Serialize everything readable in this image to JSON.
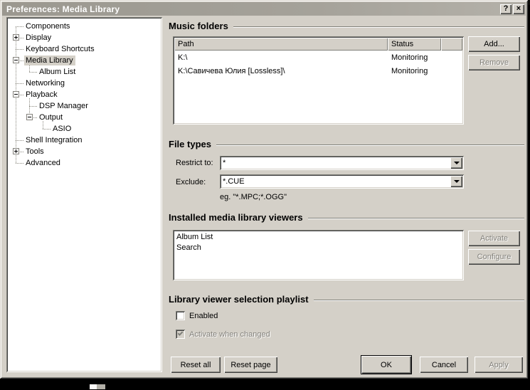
{
  "window": {
    "title": "Preferences: Media Library",
    "help_glyph": "?",
    "close_glyph": "×"
  },
  "tree": {
    "items": [
      {
        "label": "Components",
        "level": 0,
        "expander": "none",
        "selected": false
      },
      {
        "label": "Display",
        "level": 0,
        "expander": "plus",
        "selected": false
      },
      {
        "label": "Keyboard Shortcuts",
        "level": 0,
        "expander": "none",
        "selected": false
      },
      {
        "label": "Media Library",
        "level": 0,
        "expander": "minus",
        "selected": true
      },
      {
        "label": "Album List",
        "level": 1,
        "expander": "none",
        "selected": false
      },
      {
        "label": "Networking",
        "level": 0,
        "expander": "none",
        "selected": false
      },
      {
        "label": "Playback",
        "level": 0,
        "expander": "minus",
        "selected": false
      },
      {
        "label": "DSP Manager",
        "level": 1,
        "expander": "none",
        "selected": false
      },
      {
        "label": "Output",
        "level": 1,
        "expander": "minus",
        "selected": false
      },
      {
        "label": "ASIO",
        "level": 2,
        "expander": "none",
        "selected": false
      },
      {
        "label": "Shell Integration",
        "level": 0,
        "expander": "none",
        "selected": false
      },
      {
        "label": "Tools",
        "level": 0,
        "expander": "plus",
        "selected": false
      },
      {
        "label": "Advanced",
        "level": 0,
        "expander": "none",
        "selected": false
      }
    ]
  },
  "music_folders": {
    "section_title": "Music folders",
    "columns": [
      "Path",
      "Status"
    ],
    "rows": [
      {
        "path": "K:\\",
        "status": "Monitoring"
      },
      {
        "path": "K:\\Савичева Юлия [Lossless]\\",
        "status": "Monitoring"
      }
    ],
    "add_label": "Add...",
    "remove_label": "Remove"
  },
  "file_types": {
    "section_title": "File types",
    "restrict_label": "Restrict to:",
    "restrict_value": "*",
    "exclude_label": "Exclude:",
    "exclude_value": "*.CUE",
    "hint": "eg. \"*.MPC;*.OGG\""
  },
  "viewers": {
    "section_title": "Installed media library viewers",
    "items": [
      "Album List",
      "Search"
    ],
    "activate_label": "Activate",
    "configure_label": "Configure"
  },
  "selection_playlist": {
    "section_title": "Library viewer selection playlist",
    "enabled_label": "Enabled",
    "enabled_checked": false,
    "activate_changed_label": "Activate when changed",
    "activate_changed_checked": true
  },
  "footer": {
    "reset_all": "Reset all",
    "reset_page": "Reset page",
    "ok": "OK",
    "cancel": "Cancel",
    "apply": "Apply"
  },
  "colors": {
    "face": "#d4d0c8",
    "titlebar": "#a19e96",
    "title_text": "#ffffff",
    "disabled_text": "#84827c",
    "field_bg": "#ffffff"
  }
}
